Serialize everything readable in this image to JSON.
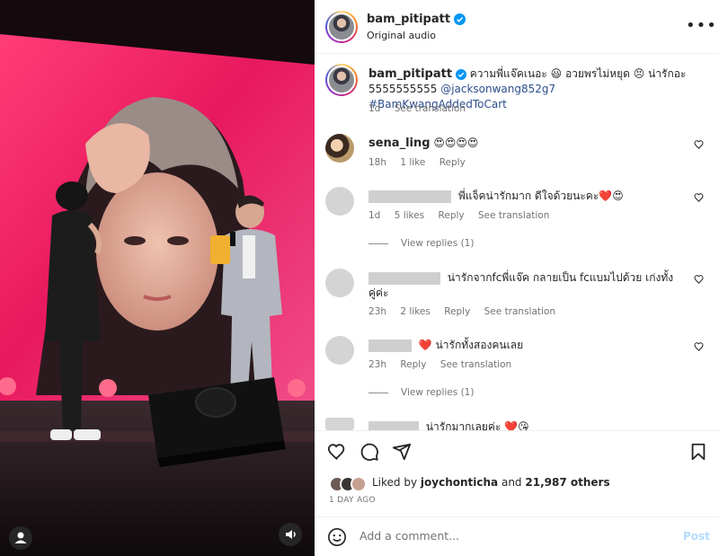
{
  "post": {
    "username": "bam_pitipatt",
    "audio_label": "Original audio",
    "more_label": "•••"
  },
  "caption": {
    "username": "bam_pitipatt",
    "text": "ความพี่แจ๊คเนอะ 😃 อวยพรไม่หยุด 😣 น่ารักอะ 5555555555",
    "mention": "@jacksonwang852g7",
    "hashtag": "#BamKwangAddedToCart",
    "time": "1d",
    "translate": "See translation"
  },
  "comments": [
    {
      "username": "sena_ling",
      "text": "😍😍😍😍",
      "time": "18h",
      "likes": "1 like",
      "reply": "Reply"
    },
    {
      "username": "",
      "text": "พี่แจ็คน่ารักมาก ดีใจด้วยนะคะ❤️😍",
      "time": "1d",
      "likes": "5 likes",
      "reply": "Reply",
      "translate": "See translation",
      "view_replies": "View replies (1)"
    },
    {
      "username": "",
      "text": "น่ารักจากfcพี่แจ๊ค กลายเป็น fcแบมไปด้วย เก่งทั้งคู่ค่ะ",
      "time": "23h",
      "likes": "2 likes",
      "reply": "Reply",
      "translate": "See translation"
    },
    {
      "username": "",
      "text": "❤️ น่ารักทั้งสองคนเลย",
      "time": "23h",
      "reply": "Reply",
      "translate": "See translation",
      "view_replies": "View replies (1)"
    },
    {
      "username": "",
      "text": "น่ารักมากเลยค่ะ ❤️😘"
    }
  ],
  "likes": {
    "prefix": "Liked by",
    "user": "joychonticha",
    "and": "and",
    "count": "21,987 others"
  },
  "date": "1 DAY AGO",
  "add_comment": {
    "placeholder": "Add a comment...",
    "post_label": "Post"
  },
  "colors": {
    "accent": "#0095f6",
    "link": "#2d4d8c",
    "like_red": "#ed4956",
    "stage_pink": "#f02d6a"
  },
  "icons": [
    "verified-badge-icon",
    "more-options-icon",
    "heart-icon",
    "comment-icon",
    "share-icon",
    "bookmark-icon",
    "emoji-icon",
    "user-tag-icon",
    "audio-icon"
  ]
}
